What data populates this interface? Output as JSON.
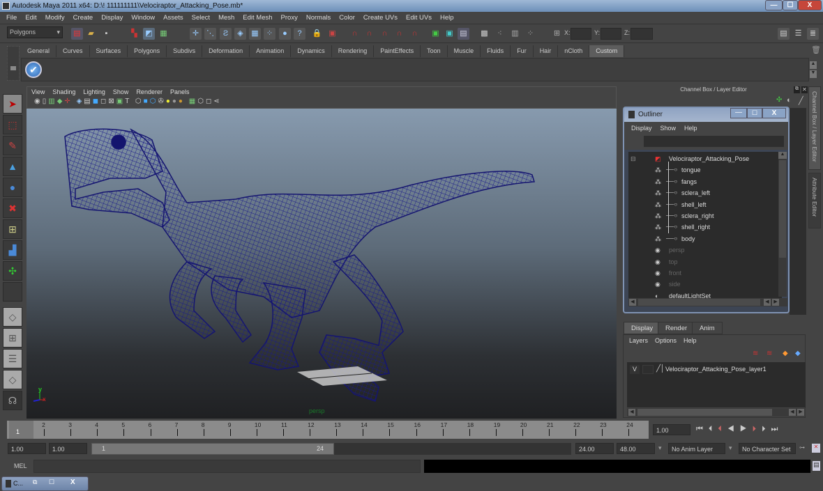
{
  "window": {
    "title": "Autodesk Maya 2011 x64: D:\\! 111111111\\Velociraptor_Attacking_Pose.mb*",
    "minimize": "—",
    "maximize": "☐",
    "close": "X"
  },
  "menubar": [
    "File",
    "Edit",
    "Modify",
    "Create",
    "Display",
    "Window",
    "Assets",
    "Select",
    "Mesh",
    "Edit Mesh",
    "Proxy",
    "Normals",
    "Color",
    "Create UVs",
    "Edit UVs",
    "Help"
  ],
  "statusline": {
    "mode_dropdown": "Polygons",
    "x_label": "X:",
    "y_label": "Y:",
    "z_label": "Z:",
    "x_value": "",
    "y_value": "",
    "z_value": ""
  },
  "shelf_tabs": [
    "General",
    "Curves",
    "Surfaces",
    "Polygons",
    "Subdivs",
    "Deformation",
    "Animation",
    "Dynamics",
    "Rendering",
    "PaintEffects",
    "Toon",
    "Muscle",
    "Fluids",
    "Fur",
    "Hair",
    "nCloth",
    "Custom"
  ],
  "shelf_active_tab": "Custom",
  "viewport": {
    "menu": [
      "View",
      "Shading",
      "Lighting",
      "Show",
      "Renderer",
      "Panels"
    ],
    "camera_label": "persp",
    "axis_y": "y",
    "axis_x": "x",
    "wireframe_color": "#1a1a8a"
  },
  "channel_box": {
    "header": "Channel Box / Layer Editor"
  },
  "side_tabs": [
    "Channel Box / Layer Editor",
    "Attribute Editor"
  ],
  "outliner": {
    "title": "Outliner",
    "menu": [
      "Display",
      "Show",
      "Help"
    ],
    "filter_value": "",
    "items": [
      {
        "label": "Velociraptor_Attacking_Pose",
        "level": 0,
        "type": "group",
        "expanded": true
      },
      {
        "label": "tongue",
        "level": 1,
        "type": "mesh"
      },
      {
        "label": "fangs",
        "level": 1,
        "type": "mesh"
      },
      {
        "label": "sclera_left",
        "level": 1,
        "type": "mesh"
      },
      {
        "label": "shell_left",
        "level": 1,
        "type": "mesh"
      },
      {
        "label": "sclera_right",
        "level": 1,
        "type": "mesh"
      },
      {
        "label": "shell_right",
        "level": 1,
        "type": "mesh"
      },
      {
        "label": "body",
        "level": 1,
        "type": "mesh"
      },
      {
        "label": "persp",
        "level": 0,
        "type": "camera",
        "dim": true
      },
      {
        "label": "top",
        "level": 0,
        "type": "camera",
        "dim": true
      },
      {
        "label": "front",
        "level": 0,
        "type": "camera",
        "dim": true
      },
      {
        "label": "side",
        "level": 0,
        "type": "camera",
        "dim": true
      },
      {
        "label": "defaultLightSet",
        "level": 0,
        "type": "set"
      }
    ]
  },
  "layer_editor": {
    "tabs": [
      "Display",
      "Render",
      "Anim"
    ],
    "active_tab": "Display",
    "menu": [
      "Layers",
      "Options",
      "Help"
    ],
    "layers": [
      {
        "visible": "V",
        "name": "Velociraptor_Attacking_Pose_layer1"
      }
    ]
  },
  "timeline": {
    "ticks": [
      "1",
      "2",
      "3",
      "4",
      "5",
      "6",
      "7",
      "8",
      "9",
      "10",
      "11",
      "12",
      "13",
      "14",
      "15",
      "16",
      "17",
      "18",
      "19",
      "20",
      "21",
      "22",
      "23",
      "24"
    ],
    "current_frame_marker": "1",
    "current_time": "1.00"
  },
  "range": {
    "start": "1.00",
    "playback_start": "1.00",
    "slider_min": "1",
    "slider_max": "24",
    "playback_end": "24.00",
    "end": "48.00",
    "anim_layer": "No Anim Layer",
    "character_set": "No Character Set"
  },
  "command_line": {
    "label": "MEL",
    "value": "",
    "result": ""
  },
  "taskbar": {
    "item_label": "C..."
  }
}
